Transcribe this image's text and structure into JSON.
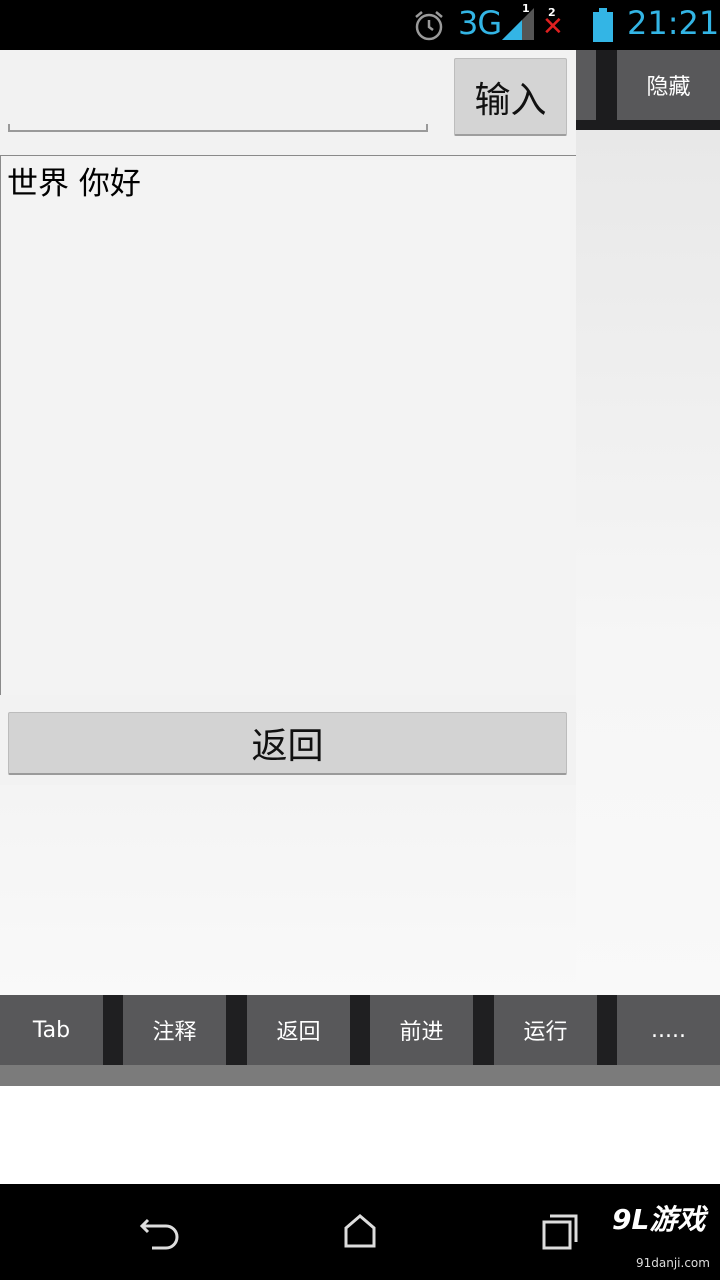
{
  "status_bar": {
    "network": "3G",
    "sim1_label": "1",
    "sim2_label": "2",
    "time": "21:21",
    "icons": [
      "alarm-icon",
      "signal-icon",
      "no-signal-icon",
      "battery-icon"
    ],
    "accent_color": "#33b5e5"
  },
  "background": {
    "hide_button_label": "隐藏"
  },
  "dialog": {
    "input_value": "",
    "input_button_label": "输入",
    "text_content": "世界 你好",
    "back_button_label": "返回"
  },
  "toolbar": {
    "buttons": [
      "Tab",
      "注释",
      "返回",
      "前进",
      "运行",
      "....."
    ]
  },
  "nav_bar": {
    "icons": [
      "back-icon",
      "home-icon",
      "recent-apps-icon"
    ],
    "watermark": "9L游戏",
    "watermark_sub": "91danji.com"
  }
}
